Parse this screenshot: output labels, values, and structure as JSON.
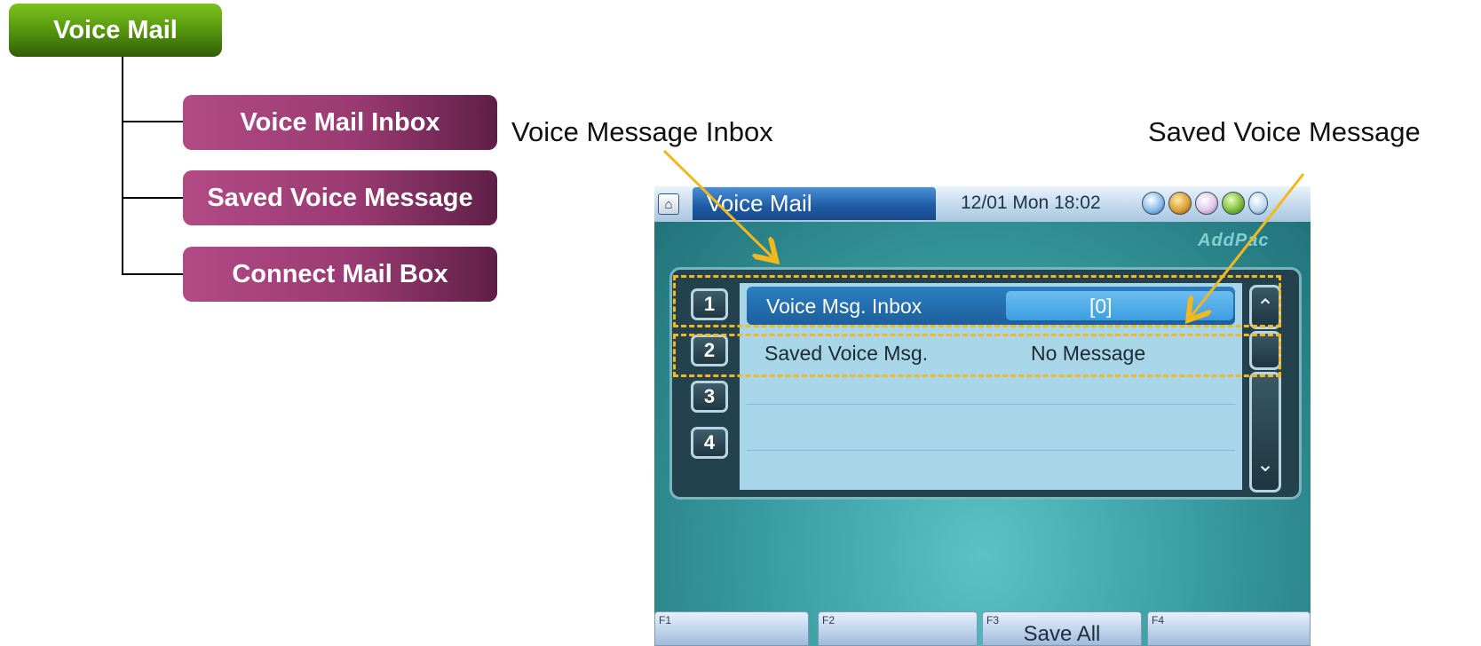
{
  "tree": {
    "root": "Voice Mail",
    "children": [
      "Voice Mail Inbox",
      "Saved Voice Message",
      "Connect Mail Box"
    ]
  },
  "callouts": {
    "left": "Voice Message Inbox",
    "right": "Saved Voice Message"
  },
  "screen": {
    "title": "Voice Mail",
    "datetime": "12/01 Mon 18:02",
    "brand": "AddPac",
    "status_icons": [
      "globe-icon",
      "speaker-icon",
      "palette-icon",
      "network-globe-icon",
      "ear-icon"
    ],
    "list": [
      {
        "num": "1",
        "label": "Voice Msg. Inbox",
        "value": "[0]",
        "selected": true
      },
      {
        "num": "2",
        "label": "Saved Voice Msg.",
        "value": "No Message",
        "selected": false
      },
      {
        "num": "3",
        "label": "",
        "value": ""
      },
      {
        "num": "4",
        "label": "",
        "value": ""
      }
    ],
    "function_keys": [
      {
        "key": "F1",
        "label": ""
      },
      {
        "key": "F2",
        "label": ""
      },
      {
        "key": "F3",
        "label": "Save All"
      },
      {
        "key": "F4",
        "label": ""
      }
    ],
    "scroll_up_icon": "⌃",
    "scroll_down_icon": "⌄"
  },
  "colors": {
    "root_green": "#5a9b10",
    "child_magenta": "#9a3a72",
    "highlight_dash": "#f2b81c",
    "selected_row": "#1d5f9d"
  }
}
